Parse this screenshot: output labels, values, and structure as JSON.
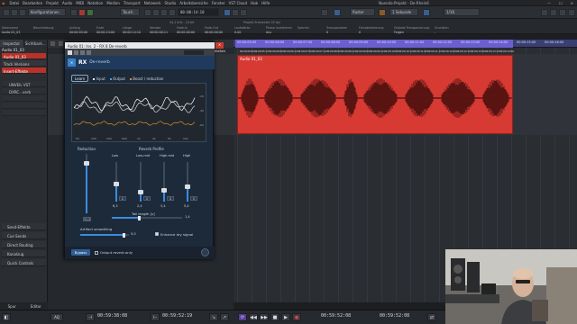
{
  "app": {
    "name": "Nuendo",
    "window_title": "Nuendo-Projekt - De-Rhein6",
    "menu": [
      "Datei",
      "Bearbeiten",
      "Projekt",
      "Audio",
      "MIDI",
      "Notation",
      "Medien",
      "Transport",
      "Netzwerk",
      "Studio",
      "Arbeitsbereiche",
      "Fenster",
      "VST Cloud",
      "Hub",
      "Hilfe"
    ]
  },
  "toolbar": {
    "config_label": "Konfigurationen",
    "touch_label": "Touch",
    "position": "00:00:14:10",
    "snap_label": "Raster",
    "quantize_label": "1 Sekunde",
    "zoom_label": "1/16"
  },
  "infoline": {
    "columns": [
      {
        "label": "Dateiname",
        "value": "Audio 01_03"
      },
      {
        "label": "Beschreibung",
        "value": ""
      },
      {
        "label": "Anfang",
        "value": "00:00:05:00"
      },
      {
        "label": "Ende",
        "value": "00:00:24:00"
      },
      {
        "label": "Länge",
        "value": "00:00:14:10"
      },
      {
        "label": "Versatz",
        "value": "00:00:00:11"
      },
      {
        "label": "Fade-In",
        "value": "00:00:00:00"
      },
      {
        "label": "Fade-Out",
        "value": "00:00:00:00"
      },
      {
        "label": "Lautstärke",
        "value": "0.00"
      },
      {
        "label": "Phase invertieren",
        "value": "Aus"
      },
      {
        "label": "Sperren",
        "value": ""
      },
      {
        "label": "Transponieren",
        "value": "0"
      },
      {
        "label": "Feinabstimmung",
        "value": "0"
      },
      {
        "label": "Globale Transponierung",
        "value": "Folgen"
      },
      {
        "label": "Grundton",
        "value": "-"
      }
    ],
    "file_info": "44,1 kHz - 24 bit",
    "record_format": "Projekt-Framerate 25 fps"
  },
  "inspector": {
    "tabs": [
      "Inspector",
      "Sichtbark..."
    ],
    "track_name": "Audio 01_03",
    "rows": [
      "Audio 01_03",
      "Track Versions",
      "Insert-Effekte",
      "UNVEIL VST",
      "DXRC...verb",
      "",
      "",
      ""
    ],
    "sections": [
      "Send-Effekte",
      "Cue Sends",
      "Direct Routing",
      "Kanalzug",
      "Quick Controls"
    ],
    "bottom_tabs": [
      "Spur",
      "Editor"
    ]
  },
  "timeline": {
    "ruler_ticks": [
      "00:00:05:00",
      "00:00:06:00",
      "00:00:07:00",
      "00:00:08:00",
      "00:00:09:00",
      "00:00:10:00",
      "00:00:11:00",
      "00:00:12:00",
      "00:00:13:00",
      "00:00:14:00",
      "00:00:15:00",
      "00:00:16:00"
    ],
    "clip_name": "Audio 01_03",
    "clip_ticks": [
      "00:00:05:00",
      "00:00:05:12",
      "00:00:06:00",
      "00:00:06:12",
      "00:00:07:00",
      "00:00:07:12",
      "00:00:08:00",
      "00:00:08:12",
      "00:00:09:00",
      "00:00:09:12",
      "00:00:10:00",
      "00:00:10:12",
      "00:00:11:00",
      "00:00:11:12",
      "00:00:12:00",
      "00:00:12:12",
      "00:00:13:00",
      "00:00:13:12",
      "00:00:14:00"
    ]
  },
  "plugin": {
    "title": "Audio 01: Ins. 2 - RX 8 De-reverb",
    "close_tooltip": "Schließen",
    "rx_badge": "RX",
    "product_name": "De-reverb",
    "learn_label": "Learn",
    "legend": [
      "Input",
      "Output",
      "Boost / reduction"
    ],
    "db_labels": [
      "-20",
      "-40",
      "-60"
    ],
    "freq_labels": [
      "50",
      "100",
      "200",
      "500",
      "1k",
      "2k",
      "5k",
      "10k"
    ],
    "reduction_label": "Reduction",
    "reduction_value": "11,2",
    "reverb_profile_label": "Reverb Profile",
    "bands": [
      {
        "label": "Low",
        "value": "6,3",
        "level": 0.45
      },
      {
        "label": "Low-mid",
        "value": "2,4",
        "level": 0.25
      },
      {
        "label": "High-mid",
        "value": "3,4",
        "level": 0.3
      },
      {
        "label": "High",
        "value": "5,4",
        "level": 0.38
      }
    ],
    "band_boxes": [
      "S",
      "S",
      "S",
      "S"
    ],
    "tail_length_label": "Tail length [s]",
    "tail_length_value": "1,4",
    "artifact_label": "Artifact smoothing",
    "artifact_value": "5,0",
    "enhance_label": "Enhance dry signal",
    "bypass_label": "Bypass",
    "output_reverb_label": "Output reverb only"
  },
  "transport": {
    "left_locator": "00:59:38:08",
    "right_locator": "00:59:52:19",
    "position": "00:59:52:08",
    "position_secondary": "00:59:52:08",
    "tempo": "120,000",
    "signature": "4/4",
    "marker": "AQ"
  },
  "colors": {
    "clip": "#d63a33",
    "loop": "#6a5ed0",
    "accent_blue": "#3a8be0",
    "plugin_bg": "#1d2a3a"
  }
}
